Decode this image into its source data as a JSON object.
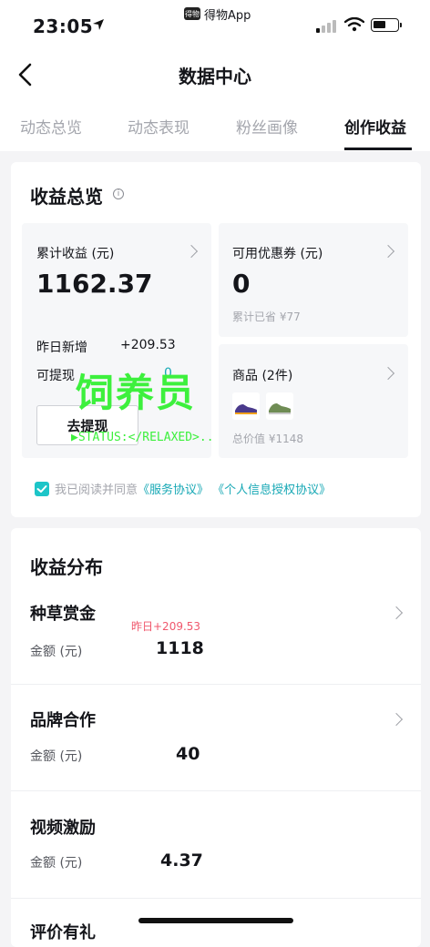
{
  "status_bar": {
    "time": "23:05",
    "app_badge_text": "得物App",
    "app_badge_icon": "得物"
  },
  "header": {
    "title": "数据中心"
  },
  "tabs": [
    {
      "label": "动态总览",
      "active": false
    },
    {
      "label": "动态表现",
      "active": false
    },
    {
      "label": "粉丝画像",
      "active": false
    },
    {
      "label": "创作收益",
      "active": true
    }
  ],
  "overview": {
    "title": "收益总览",
    "info_glyph": "i",
    "cumulative": {
      "label": "累计收益 (元)",
      "value": "1162.37",
      "yesterday_label": "昨日新增",
      "yesterday_value": "+209.53",
      "withdrawable_label": "可提现",
      "withdrawable_value": "0",
      "withdraw_button": "去提现"
    },
    "coupons": {
      "label": "可用优惠券 (元)",
      "value": "0",
      "saved": "累计已省 ¥77"
    },
    "goods": {
      "label": "商品 (2件)",
      "total": "总价值 ¥1148"
    },
    "agreement": {
      "prefix": "我已阅读并同意",
      "link1": "《服务协议》",
      "link2": "《个人信息授权协议》",
      "checked": true
    }
  },
  "overlay": {
    "text": "饲养员",
    "status": "▶STATUS:</RELAXED>..",
    "color": "#3df03d"
  },
  "distribution": {
    "title": "收益分布",
    "items": [
      {
        "name": "种草赏金",
        "amount_label": "金额 (元)",
        "amount": "1118",
        "badge": "昨日+209.53"
      },
      {
        "name": "品牌合作",
        "amount_label": "金额 (元)",
        "amount": "40"
      },
      {
        "name": "视频激励",
        "amount_label": "金额 (元)",
        "amount": "4.37"
      },
      {
        "name": "评价有礼"
      }
    ]
  },
  "colors": {
    "accent": "#17a8b5",
    "checkbox": "#1dc5c8",
    "badge_red": "#f0576c"
  }
}
